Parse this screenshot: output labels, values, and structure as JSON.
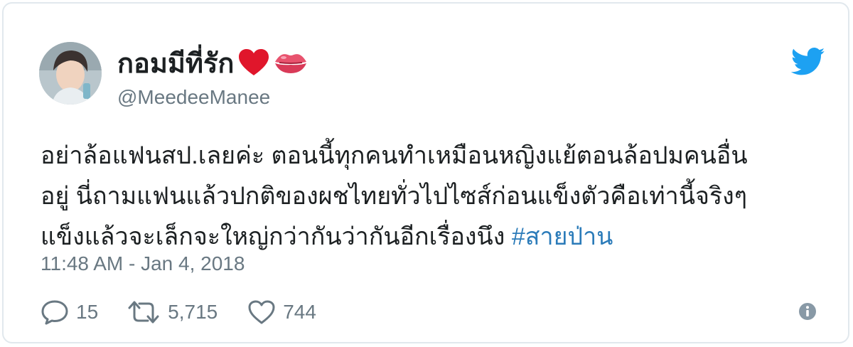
{
  "tweet": {
    "author": {
      "display_name": "กอมมีที่รัก",
      "name_emojis": [
        "heart-icon",
        "kiss-mark-icon"
      ],
      "handle": "@MeedeeManee"
    },
    "text_lines": [
      "อย่าล้อแฟนสป.เลยค่ะ ตอนนี้ทุกคนทำเหมือนหญิงแย้ตอนล้อปมคนอื่น",
      "อยู่ นี่ถามแฟนแล้วปกติของผชไทยทั่วไปไซส์ก่อนแข็งตัวคือเท่านี้จริงๆ",
      "แข็งแล้วจะเล็กจะใหญ่กว่ากันว่ากันอีกเรื่องนึง "
    ],
    "hashtag": "#สายป่าน",
    "timestamp": "11:48 AM - Jan 4, 2018",
    "stats": {
      "replies": "15",
      "retweets": "5,715",
      "likes": "744"
    }
  },
  "colors": {
    "text": "#1c2022",
    "secondary": "#697882",
    "link": "#2b7bb9",
    "twitter_blue": "#1da1f2",
    "heart_red": "#e0162b",
    "border": "#e1e8ed"
  },
  "icons": {
    "brand": "twitter-bird-icon",
    "reply": "reply-bubble-icon",
    "retweet": "retweet-icon",
    "like": "heart-outline-icon",
    "info": "info-icon"
  }
}
